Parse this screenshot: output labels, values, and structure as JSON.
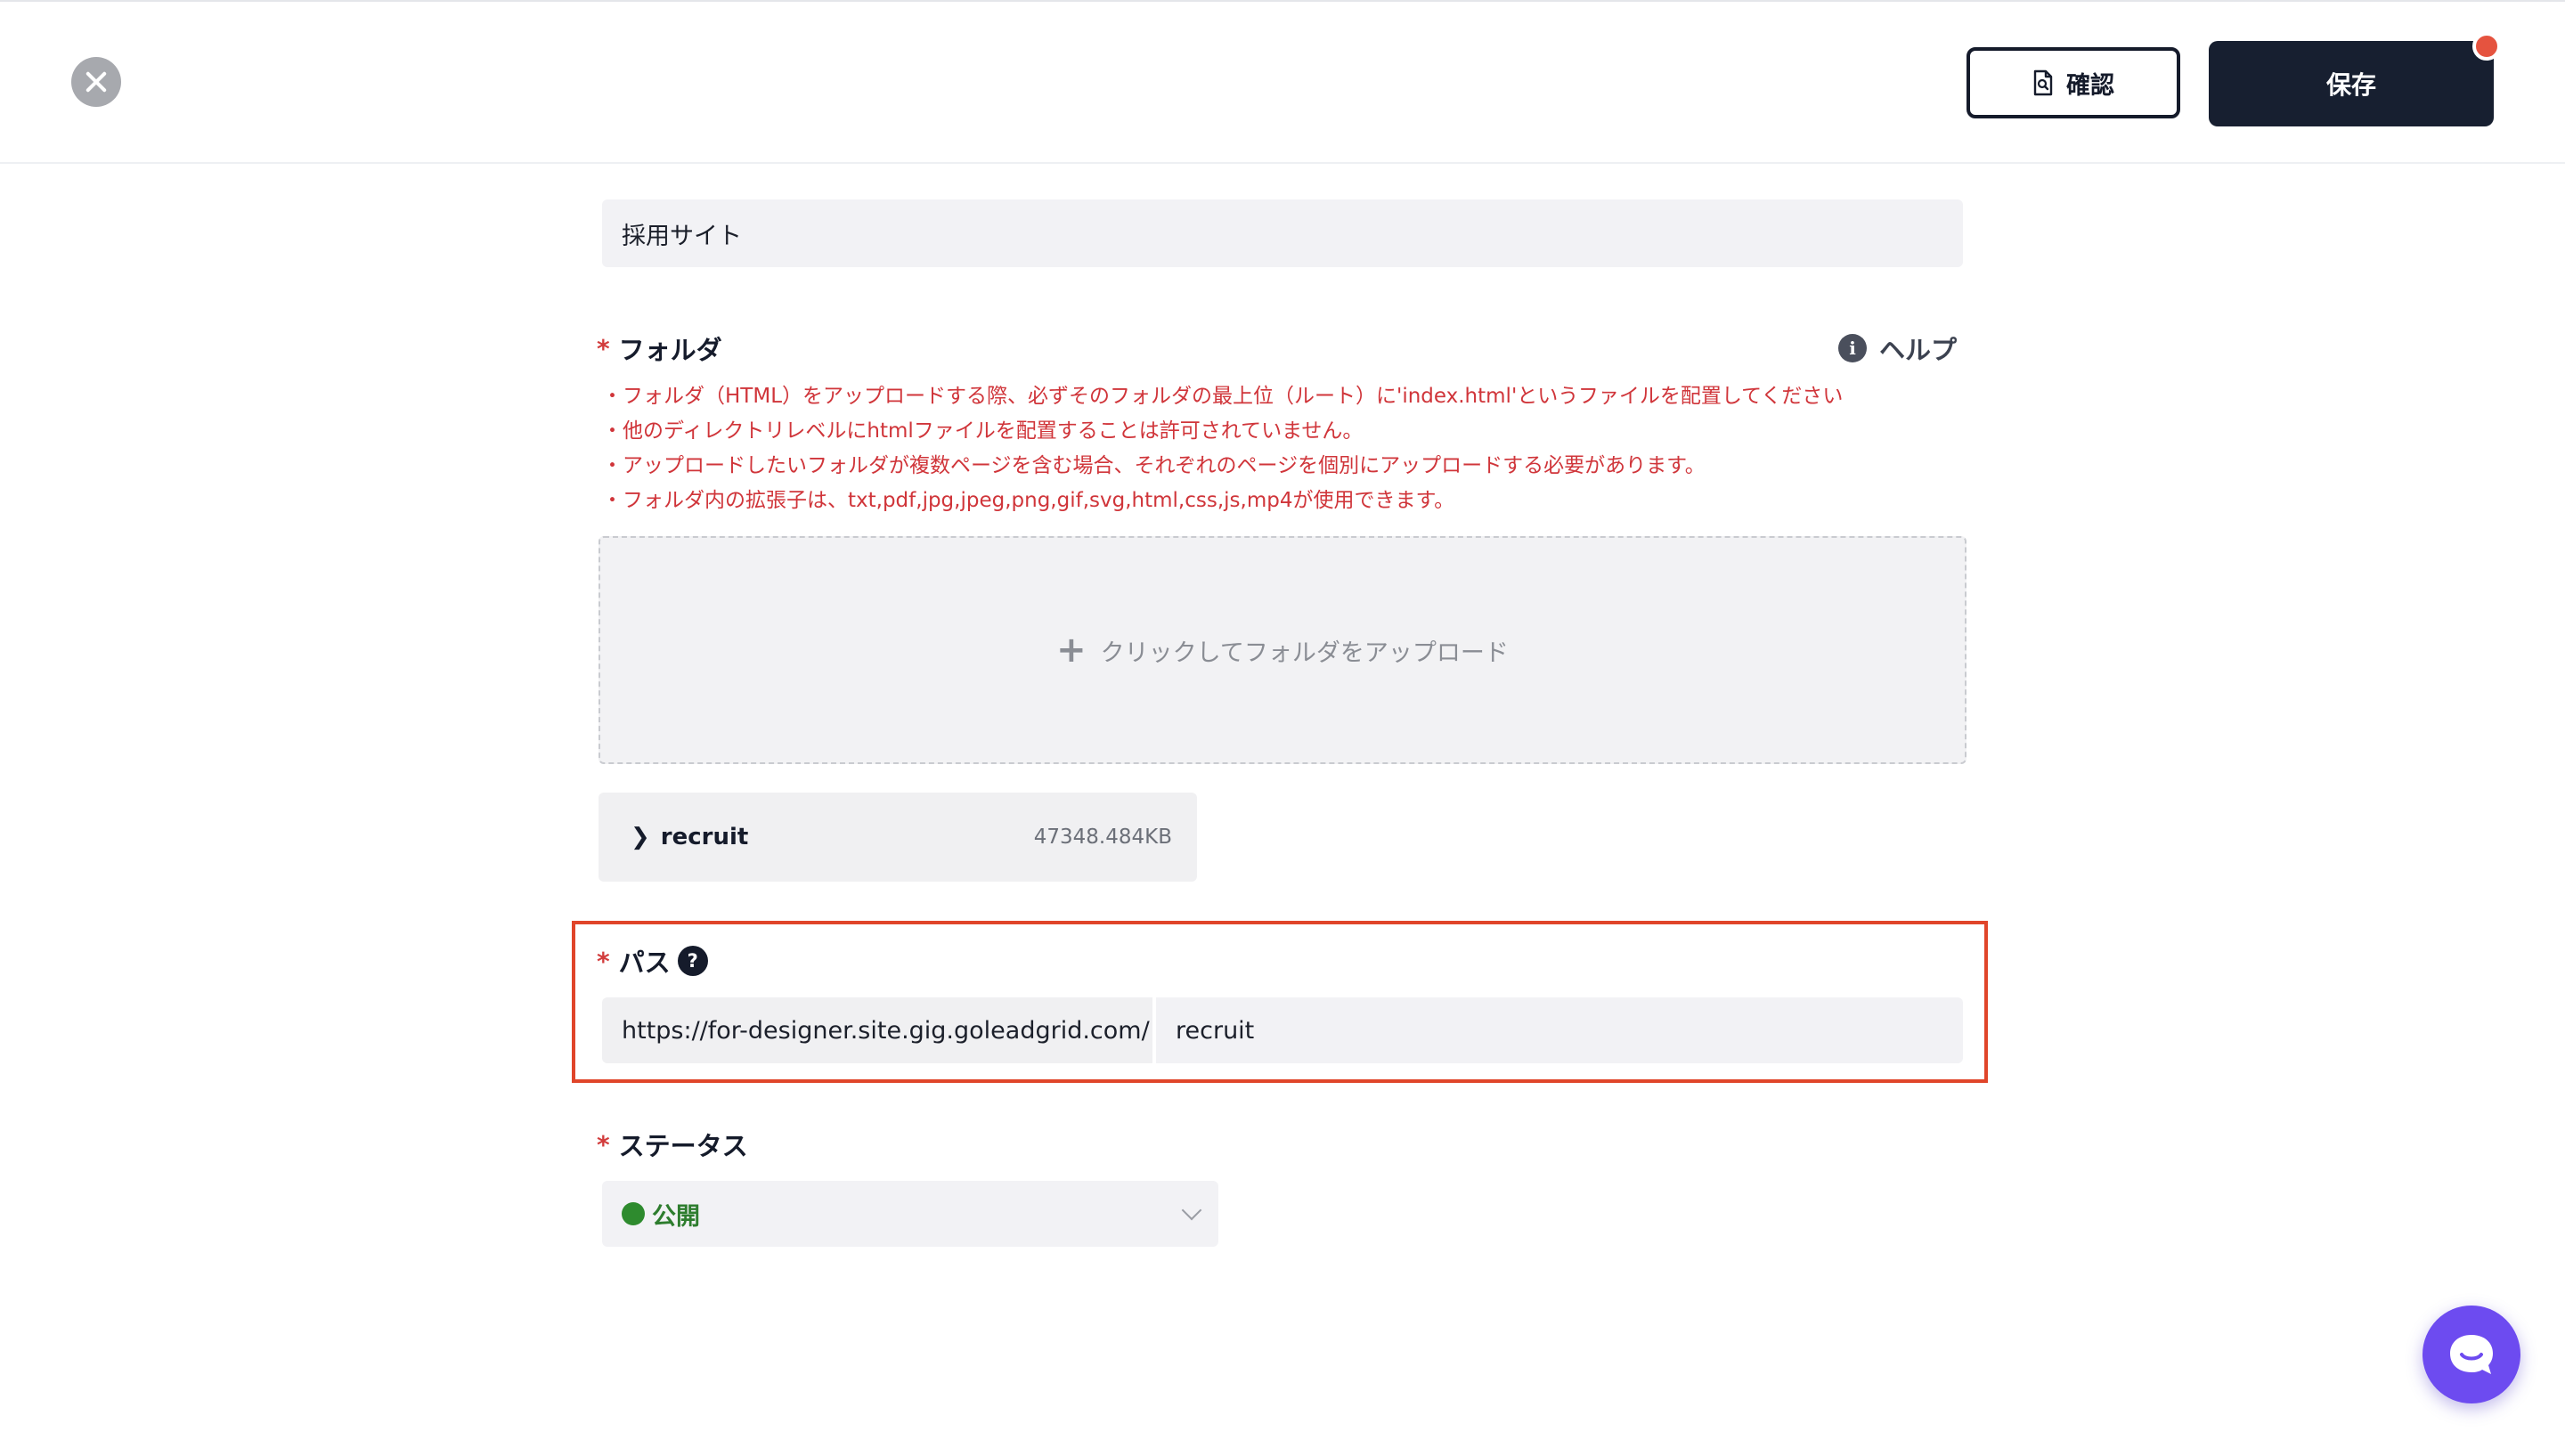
{
  "header": {
    "confirm_label": "確認",
    "save_label": "保存"
  },
  "site_name": {
    "value": "採用サイト"
  },
  "folder": {
    "required_mark": "*",
    "label": "フォルダ",
    "help_label": "ヘルプ",
    "notes": [
      "・フォルダ（HTML）をアップロードする際、必ずそのフォルダの最上位（ルート）に'index.html'というファイルを配置してください",
      "・他のディレクトリレベルにhtmlファイルを配置することは許可されていません。",
      "・アップロードしたいフォルダが複数ページを含む場合、それぞれのページを個別にアップロードする必要があります。",
      "・フォルダ内の拡張子は、txt,pdf,jpg,jpeg,png,gif,svg,html,css,js,mp4が使用できます。"
    ],
    "upload_label": "クリックしてフォルダをアップロード",
    "file": {
      "name": "recruit",
      "size": "47348.484KB"
    }
  },
  "path": {
    "required_mark": "*",
    "label": "パス",
    "question_mark": "?",
    "prefix": "https://for-designer.site.gig.goleadgrid.com/",
    "value": "recruit"
  },
  "status": {
    "required_mark": "*",
    "label": "ステータス",
    "selected": "公開",
    "selected_color": "#2e8b2e"
  },
  "colors": {
    "accent_dark": "#171f30",
    "required_red": "#d23c3c",
    "highlight": "#e0452a",
    "chat": "#6d4bf0"
  },
  "icons": {
    "close": "close-icon",
    "document": "document-search-icon",
    "info": "info-icon",
    "plus": "plus-icon",
    "chevron_right": "chevron-right-icon",
    "question": "question-icon",
    "chevron_down": "chevron-down-icon",
    "chat": "chat-icon"
  }
}
